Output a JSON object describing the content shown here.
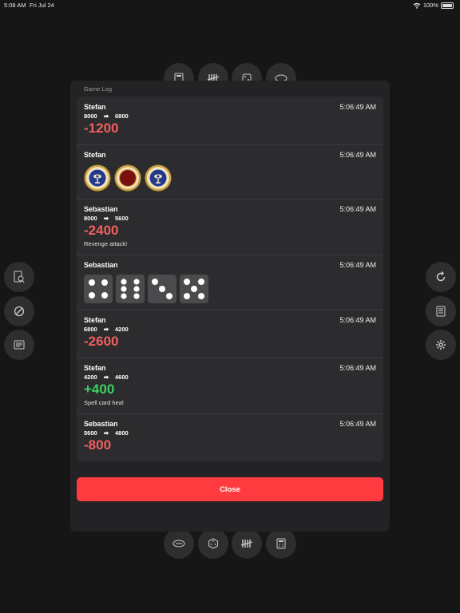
{
  "status_bar": {
    "time": "5:08 AM",
    "date": "Fri Jul 24",
    "battery": "100%"
  },
  "toolbar_top": [
    "calculator-icon",
    "tally-icon",
    "dice-icon",
    "coin-icon"
  ],
  "toolbar_bottom": [
    "coin-icon",
    "dice-icon",
    "tally-icon",
    "calculator-icon"
  ],
  "left_buttons": [
    "card-search-icon",
    "no-entry-icon",
    "book-icon"
  ],
  "right_buttons": [
    "reset-icon",
    "log-icon",
    "gear-icon"
  ],
  "modal": {
    "title": "Game Log",
    "close_label": "Close",
    "entries": [
      {
        "player": "Stefan",
        "time": "5:06:49 AM",
        "type": "lp",
        "from": "8000",
        "arrow": "➡",
        "to": "6800",
        "delta": "-1200",
        "note": ""
      },
      {
        "player": "Stefan",
        "time": "5:06:49 AM",
        "type": "coins",
        "coins": [
          "heads",
          "tails",
          "heads"
        ]
      },
      {
        "player": "Sebastian",
        "time": "5:06:49 AM",
        "type": "lp",
        "from": "8000",
        "arrow": "➡",
        "to": "5600",
        "delta": "-2400",
        "note": "Revenge attack!"
      },
      {
        "player": "Sebastian",
        "time": "5:06:49 AM",
        "type": "dice",
        "dice": [
          4,
          6,
          3,
          5
        ]
      },
      {
        "player": "Stefan",
        "time": "5:06:49 AM",
        "type": "lp",
        "from": "6800",
        "arrow": "➡",
        "to": "4200",
        "delta": "-2600",
        "note": ""
      },
      {
        "player": "Stefan",
        "time": "5:06:49 AM",
        "type": "lp",
        "from": "4200",
        "arrow": "➡",
        "to": "4600",
        "delta": "+400",
        "note": "Spell card heal"
      },
      {
        "player": "Sebastian",
        "time": "5:06:49 AM",
        "type": "lp",
        "from": "5600",
        "arrow": "➡",
        "to": "4800",
        "delta": "-800",
        "note": ""
      }
    ]
  },
  "colors": {
    "accent": "#ff3b3f",
    "negative": "#f25f5f",
    "positive": "#3cd160"
  }
}
